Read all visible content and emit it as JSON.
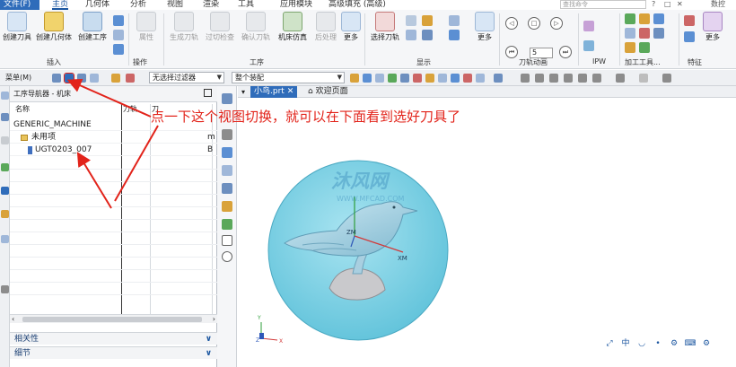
{
  "menu_tabs": [
    "文件(F)",
    "主页",
    "几何体",
    "分析",
    "视图",
    "渲染",
    "工具",
    "应用模块",
    "高级填充 (高级)"
  ],
  "search_placeholder": "查找命令",
  "window_controls": {
    "help": "?",
    "restore": "□",
    "question": "✕",
    "more": "数控"
  },
  "ribbon": {
    "insert_buttons": [
      "创建刀具",
      "创建几何体",
      "创建工序"
    ],
    "op_buttons": [
      "属性"
    ],
    "process_buttons": [
      "生成刀轨",
      "过切检查",
      "确认刀轨",
      "机床仿真",
      "后处理",
      "更多"
    ],
    "display_buttons": [
      "选择刀轨"
    ],
    "more_label": "更多",
    "num_value": "5",
    "groups": {
      "insert": "插入",
      "operations": "操作",
      "process": "工序",
      "display": "显示",
      "toolpath_animation": "刀轨动画",
      "ipw": "IPW",
      "machining_tools": "加工工具...",
      "features": "特征"
    }
  },
  "toolbar2": {
    "menu_label": "菜单(M)",
    "filter_combo": "无选择过滤器",
    "assembly_combo": "整个装配"
  },
  "navigator": {
    "title": "工序导航器 - 机床",
    "columns": [
      "名称",
      "刀轨",
      "刀"
    ],
    "rows": [
      {
        "name": "GENERIC_MACHINE",
        "col3": ""
      },
      {
        "name": "未用项",
        "col3": "m"
      },
      {
        "name": "UGT0203_007",
        "col3": "B"
      }
    ],
    "sections": [
      "相关性",
      "细节"
    ]
  },
  "doc_tabs": {
    "active": "小鸟.prt",
    "home": "欢迎页面"
  },
  "annotation_text": "点一下这个视图切换，就可以在下面看到选好刀具了",
  "model_labels": {
    "zm": "ZM",
    "xm": "XM",
    "y": "Y",
    "x": "X",
    "z": "Z"
  },
  "watermark": {
    "brand": "沐风网",
    "url": "WWW.MFCAD.COM"
  },
  "view_tools": [
    "⤢",
    "中",
    "◡",
    "•",
    "⚙",
    "⌨",
    "⚙"
  ],
  "colors": {
    "accent": "#2f6cba",
    "annotation": "#e2231a",
    "disk": "#7fd3e6",
    "bird": "#8fc9de"
  }
}
